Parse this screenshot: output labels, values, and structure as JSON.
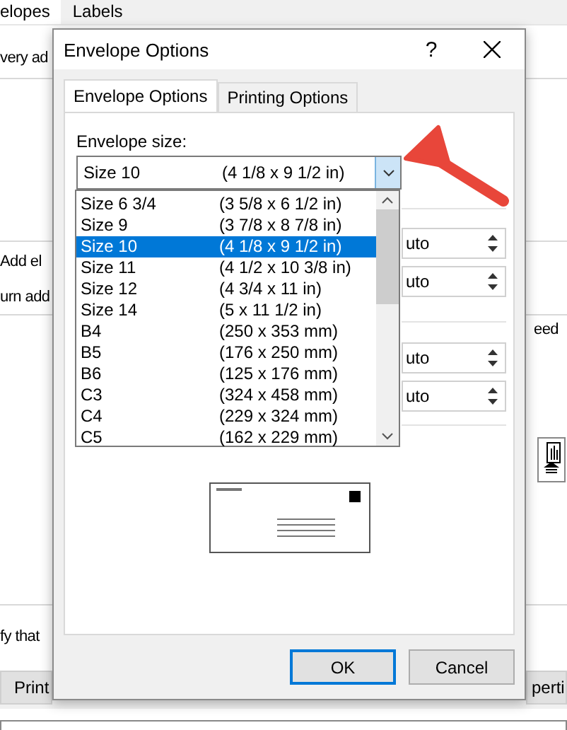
{
  "background_window": {
    "tabs": [
      {
        "label": "elopes",
        "selected": true
      },
      {
        "label": "Labels",
        "selected": false
      }
    ],
    "texts": [
      "very ad",
      "Add el",
      "urn add",
      "eed",
      "fy that"
    ],
    "buttons": [
      "Print",
      "perti"
    ]
  },
  "dialog": {
    "title": "Envelope Options",
    "help": "?",
    "tabs": [
      {
        "label": "Envelope Options",
        "selected": true
      },
      {
        "label": "Printing Options",
        "selected": false
      }
    ],
    "size_label": "Envelope size:",
    "size_combo": {
      "name": "Size 10",
      "dimensions": "(4 1/8 x 9 1/2 in)",
      "expanded": true
    },
    "size_options": [
      {
        "name": "Size 6 3/4",
        "dimensions": "(3 5/8 x 6 1/2 in)",
        "selected": false
      },
      {
        "name": "Size 9",
        "dimensions": "(3 7/8 x 8 7/8 in)",
        "selected": false
      },
      {
        "name": "Size 10",
        "dimensions": "(4 1/8 x 9 1/2 in)",
        "selected": true
      },
      {
        "name": "Size 11",
        "dimensions": "(4 1/2 x 10 3/8 in)",
        "selected": false
      },
      {
        "name": "Size 12",
        "dimensions": "(4 3/4 x 11 in)",
        "selected": false
      },
      {
        "name": "Size 14",
        "dimensions": "(5 x 11 1/2 in)",
        "selected": false
      },
      {
        "name": "B4",
        "dimensions": "(250 x 353 mm)",
        "selected": false
      },
      {
        "name": "B5",
        "dimensions": "(176 x 250 mm)",
        "selected": false
      },
      {
        "name": "B6",
        "dimensions": "(125 x 176 mm)",
        "selected": false
      },
      {
        "name": "C3",
        "dimensions": "(324 x 458 mm)",
        "selected": false
      },
      {
        "name": "C4",
        "dimensions": "(229 x 324 mm)",
        "selected": false
      },
      {
        "name": "C5",
        "dimensions": "(162 x 229 mm)",
        "selected": false
      }
    ],
    "spin_fields": [
      "uto",
      "uto",
      "uto",
      "uto"
    ],
    "buttons": [
      {
        "label": "OK",
        "default": true
      },
      {
        "label": "Cancel",
        "default": false
      }
    ]
  }
}
